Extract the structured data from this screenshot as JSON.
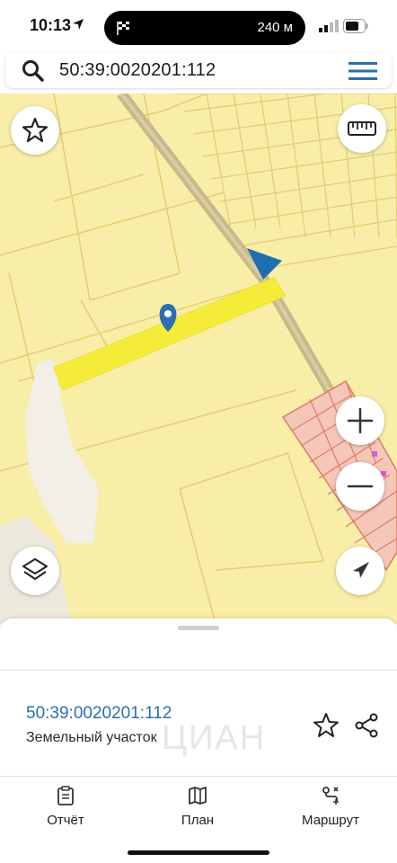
{
  "status": {
    "time": "10:13",
    "island_text": "240 м"
  },
  "search": {
    "query": "50:39:0020201:112"
  },
  "map_controls": {
    "favorite": "star-icon",
    "ruler": "ruler-icon",
    "zoom_in": "plus-icon",
    "zoom_out": "minus-icon",
    "layers": "layers-icon",
    "locate": "locate-icon"
  },
  "parcel": {
    "cadastral_number": "50:39:0020201:112",
    "type": "Земельный участок",
    "highlight_color": "#f5ec3a"
  },
  "watermark": "ЦИАН",
  "tabs": [
    {
      "label": "Отчёт",
      "icon": "clipboard-icon"
    },
    {
      "label": "План",
      "icon": "map-icon"
    },
    {
      "label": "Маршрут",
      "icon": "route-icon"
    }
  ],
  "colors": {
    "accent": "#2a6fb0",
    "map_bg": "#f8eea8",
    "road": "#c9b98a",
    "red_parcels": "#e07a6a"
  }
}
